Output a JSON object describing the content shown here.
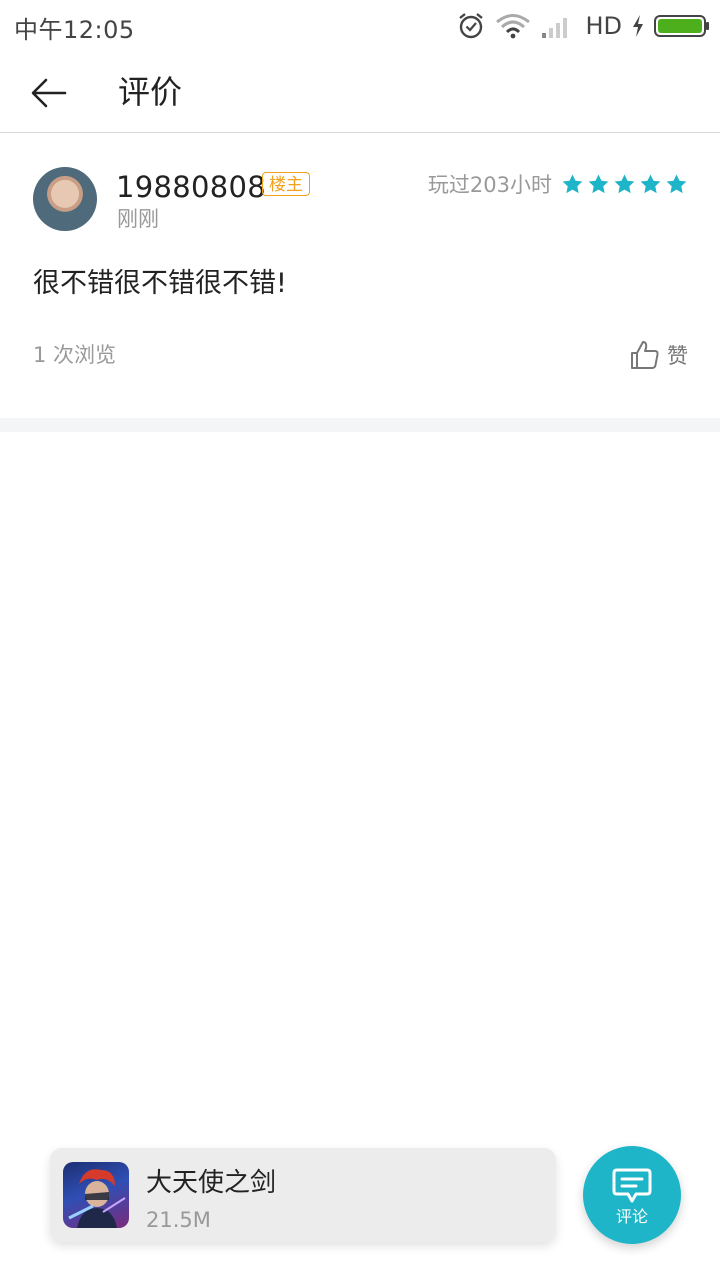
{
  "status_bar": {
    "time": "中午12:05",
    "network": "HD"
  },
  "header": {
    "title": "评价"
  },
  "review": {
    "author": "19880808",
    "badge": "楼主",
    "posted": "刚刚",
    "play_time": "玩过203小时",
    "rating": 5,
    "text": "很不错很不错很不错!",
    "views": "1 次浏览",
    "like_label": "赞"
  },
  "app_bar": {
    "name": "大天使之剑",
    "size": "21.5M"
  },
  "fab": {
    "label": "评论"
  },
  "icons": {
    "back": "arrow-left-icon",
    "like": "thumbs-up-icon",
    "comment": "comment-icon",
    "star": "star-icon",
    "alarm": "alarm-icon",
    "wifi": "wifi-icon",
    "signal": "signal-icon",
    "charging": "charging-icon",
    "battery": "battery-icon"
  },
  "colors": {
    "accent": "#1db5c7",
    "badge": "#f2a21c",
    "battery": "#4caf1b"
  }
}
